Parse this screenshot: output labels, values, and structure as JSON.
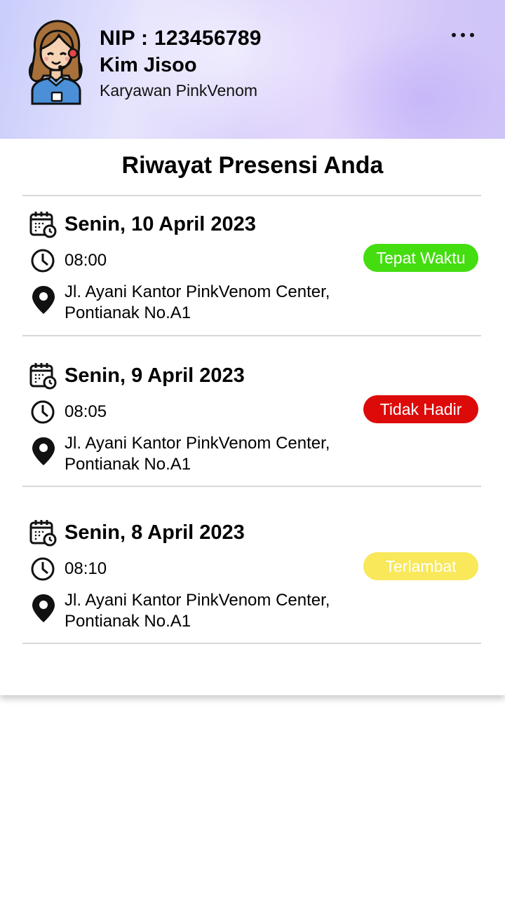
{
  "header": {
    "nip": "NIP : 123456789",
    "name": "Kim Jisoo",
    "role": "Karyawan PinkVenom",
    "menu_icon": "more-horizontal-icon"
  },
  "main": {
    "title": "Riwayat Presensi Anda",
    "entries": [
      {
        "date": "Senin, 10 April 2023",
        "time": "08:00",
        "address_line1": "Jl. Ayani Kantor PinkVenom Center,",
        "address_line2": "Pontianak No.A1",
        "status": "Tepat Waktu",
        "status_color": "#44dd10",
        "status_text_color": "#ffffff"
      },
      {
        "date": "Senin, 9 April 2023",
        "time": "08:05",
        "address_line1": "Jl. Ayani Kantor PinkVenom Center,",
        "address_line2": "Pontianak No.A1",
        "status": "Tidak Hadir",
        "status_color": "#dd0a0a",
        "status_text_color": "#ffffff"
      },
      {
        "date": "Senin, 8 April 2023",
        "time": "08:10",
        "address_line1": "Jl. Ayani Kantor PinkVenom Center,",
        "address_line2": "Pontianak No.A1",
        "status": "Terlambat",
        "status_color": "#f8e85a",
        "status_text_color": "#ffffff"
      }
    ]
  }
}
